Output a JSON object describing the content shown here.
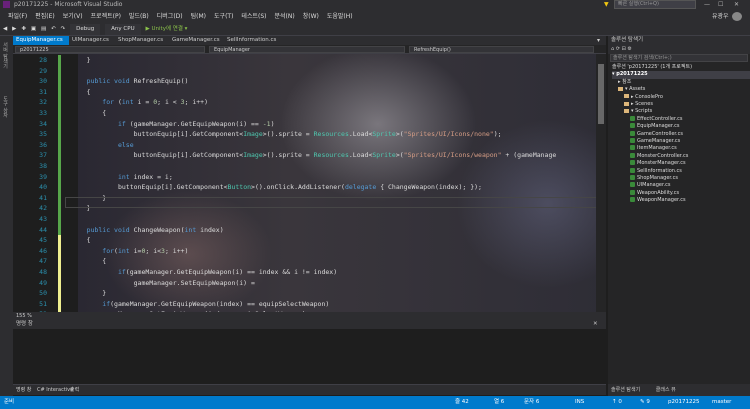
{
  "window": {
    "title": "p20171225 - Microsoft Visual Studio",
    "quick_launch": "빠른 실행(Ctrl+Q)",
    "user": "유광우"
  },
  "menu": [
    "파일(F)",
    "편집(E)",
    "보기(V)",
    "프로젝트(P)",
    "빌드(B)",
    "디버그(D)",
    "팀(M)",
    "도구(T)",
    "테스트(S)",
    "분석(N)",
    "창(W)",
    "도움말(H)"
  ],
  "toolbar": {
    "config": "Debug",
    "platform": "Any CPU",
    "attach": "▶ Unity에 연결 ▾"
  },
  "left_tabs": [
    "서버 탐색기",
    "도구 상자"
  ],
  "doc_tabs": [
    "EquipManager.cs",
    "UIManager.cs",
    "ShopManager.cs",
    "GameManager.cs",
    "SellInformation.cs"
  ],
  "nav": {
    "project": "p20171225",
    "class": "EquipManager",
    "member": "RefreshEquip()"
  },
  "code_lines": [
    {
      "n": "28",
      "t": [
        [
          "pl",
          "    }"
        ]
      ]
    },
    {
      "n": "29",
      "t": []
    },
    {
      "n": "30",
      "t": [
        [
          "kw",
          "    public void "
        ],
        [
          "pl",
          "RefreshEquip()"
        ]
      ]
    },
    {
      "n": "31",
      "t": [
        [
          "pl",
          "    {"
        ]
      ]
    },
    {
      "n": "32",
      "t": [
        [
          "kw",
          "        for "
        ],
        [
          "pl",
          "("
        ],
        [
          "kw",
          "int "
        ],
        [
          "pl",
          "i = "
        ],
        [
          "nm",
          "0"
        ],
        [
          "pl",
          "; i < "
        ],
        [
          "nm",
          "3"
        ],
        [
          "pl",
          "; i++)"
        ]
      ]
    },
    {
      "n": "33",
      "t": [
        [
          "pl",
          "        {"
        ]
      ]
    },
    {
      "n": "34",
      "t": [
        [
          "kw",
          "            if "
        ],
        [
          "pl",
          "(gameManager.GetEquipWeapon(i) == "
        ],
        [
          "nm",
          "-1"
        ],
        [
          "pl",
          ")"
        ]
      ]
    },
    {
      "n": "35",
      "t": [
        [
          "pl",
          "                buttonEquip[i].GetComponent<"
        ],
        [
          "ty",
          "Image"
        ],
        [
          "pl",
          ">().sprite = "
        ],
        [
          "ty",
          "Resources"
        ],
        [
          "pl",
          ".Load<"
        ],
        [
          "ty",
          "Sprite"
        ],
        [
          "pl",
          ">("
        ],
        [
          "st",
          "\"Sprites/UI/Icons/none\""
        ],
        [
          "pl",
          ");"
        ]
      ]
    },
    {
      "n": "36",
      "t": [
        [
          "kw",
          "            else"
        ]
      ]
    },
    {
      "n": "37",
      "t": [
        [
          "pl",
          "                buttonEquip[i].GetComponent<"
        ],
        [
          "ty",
          "Image"
        ],
        [
          "pl",
          ">().sprite = "
        ],
        [
          "ty",
          "Resources"
        ],
        [
          "pl",
          ".Load<"
        ],
        [
          "ty",
          "Sprite"
        ],
        [
          "pl",
          ">("
        ],
        [
          "st",
          "\"Sprites/UI/Icons/weapon\""
        ],
        [
          "pl",
          " + (gameManage"
        ]
      ]
    },
    {
      "n": "38",
      "t": []
    },
    {
      "n": "39",
      "t": [
        [
          "kw",
          "            int "
        ],
        [
          "pl",
          "index = i;"
        ]
      ]
    },
    {
      "n": "40",
      "t": [
        [
          "pl",
          "            buttonEquip[i].GetComponent<"
        ],
        [
          "ty",
          "Button"
        ],
        [
          "pl",
          ">().onClick.AddListener("
        ],
        [
          "kw",
          "delegate "
        ],
        [
          "pl",
          "{ ChangeWeapon(index); });"
        ]
      ]
    },
    {
      "n": "41",
      "t": [
        [
          "pl",
          "        }"
        ]
      ]
    },
    {
      "n": "42",
      "t": [
        [
          "pl",
          "    }"
        ]
      ]
    },
    {
      "n": "43",
      "t": []
    },
    {
      "n": "44",
      "t": [
        [
          "kw",
          "    public void "
        ],
        [
          "pl",
          "ChangeWeapon("
        ],
        [
          "kw",
          "int "
        ],
        [
          "pl",
          "index)"
        ]
      ]
    },
    {
      "n": "45",
      "t": [
        [
          "pl",
          "    {"
        ]
      ]
    },
    {
      "n": "46",
      "t": [
        [
          "kw",
          "        for"
        ],
        [
          "pl",
          "("
        ],
        [
          "kw",
          "int "
        ],
        [
          "pl",
          "i="
        ],
        [
          "nm",
          "0"
        ],
        [
          "pl",
          "; i<"
        ],
        [
          "nm",
          "3"
        ],
        [
          "pl",
          "; i++)"
        ]
      ]
    },
    {
      "n": "47",
      "t": [
        [
          "pl",
          "        {"
        ]
      ]
    },
    {
      "n": "48",
      "t": [
        [
          "kw",
          "            if"
        ],
        [
          "pl",
          "(gameManager.GetEquipWeapon(i) == index && i != index)"
        ]
      ]
    },
    {
      "n": "49",
      "t": [
        [
          "pl",
          "                gameManager.SetEquipWeapon(i) ="
        ]
      ]
    },
    {
      "n": "50",
      "t": [
        [
          "pl",
          "        }"
        ]
      ]
    },
    {
      "n": "51",
      "t": [
        [
          "kw",
          "        if"
        ],
        [
          "pl",
          "(gameManager.GetEquipWeapon(index) == equipSelectWeapon)"
        ]
      ]
    },
    {
      "n": "52",
      "t": [
        [
          "pl",
          "        gameManager.SetEquipWeapon(index, equipSelectWeapon);"
        ]
      ]
    }
  ],
  "zoom": "155 %",
  "output_header": "명령 창",
  "bottom_tabs": [
    "명령 창",
    "C# Interactive",
    "출력"
  ],
  "solution": {
    "header": "솔루션 탐색기",
    "search_placeholder": "솔루션 탐색기 검색(Ctrl+;)",
    "tree": [
      {
        "d": 0,
        "k": "none",
        "label": "솔루션 'p20171225' (1개 프로젝트)"
      },
      {
        "d": 0,
        "k": "sel",
        "label": "▾ p20171225"
      },
      {
        "d": 1,
        "k": "none",
        "label": "▸ 참조"
      },
      {
        "d": 1,
        "k": "folder",
        "label": "▾ Assets"
      },
      {
        "d": 2,
        "k": "folder",
        "label": "▸ ConsolePro"
      },
      {
        "d": 2,
        "k": "folder",
        "label": "▸ Scenes"
      },
      {
        "d": 2,
        "k": "folder",
        "label": "▾ Scripts"
      },
      {
        "d": 3,
        "k": "cs",
        "label": "EffectController.cs"
      },
      {
        "d": 3,
        "k": "cs",
        "label": "EquipManager.cs"
      },
      {
        "d": 3,
        "k": "cs",
        "label": "GameController.cs"
      },
      {
        "d": 3,
        "k": "cs",
        "label": "GameManager.cs"
      },
      {
        "d": 3,
        "k": "cs",
        "label": "ItemManager.cs"
      },
      {
        "d": 3,
        "k": "cs",
        "label": "MonsterController.cs"
      },
      {
        "d": 3,
        "k": "cs",
        "label": "MonsterManager.cs"
      },
      {
        "d": 3,
        "k": "cs",
        "label": "SellInformation.cs"
      },
      {
        "d": 3,
        "k": "cs",
        "label": "ShopManager.cs"
      },
      {
        "d": 3,
        "k": "cs",
        "label": "UIManager.cs"
      },
      {
        "d": 3,
        "k": "cs",
        "label": "WeaponAbility.cs"
      },
      {
        "d": 3,
        "k": "cs",
        "label": "WeaponManager.cs"
      }
    ],
    "bottom_tabs": [
      "솔루션 탐색기",
      "클래스 뷰"
    ]
  },
  "status": {
    "ready": "준비",
    "line": "줄 42",
    "col": "열 6",
    "char": "문자 6",
    "ins": "INS",
    "up": "↑ 0",
    "edits": "✎ 9",
    "project": "p20171225",
    "branch": "master"
  }
}
